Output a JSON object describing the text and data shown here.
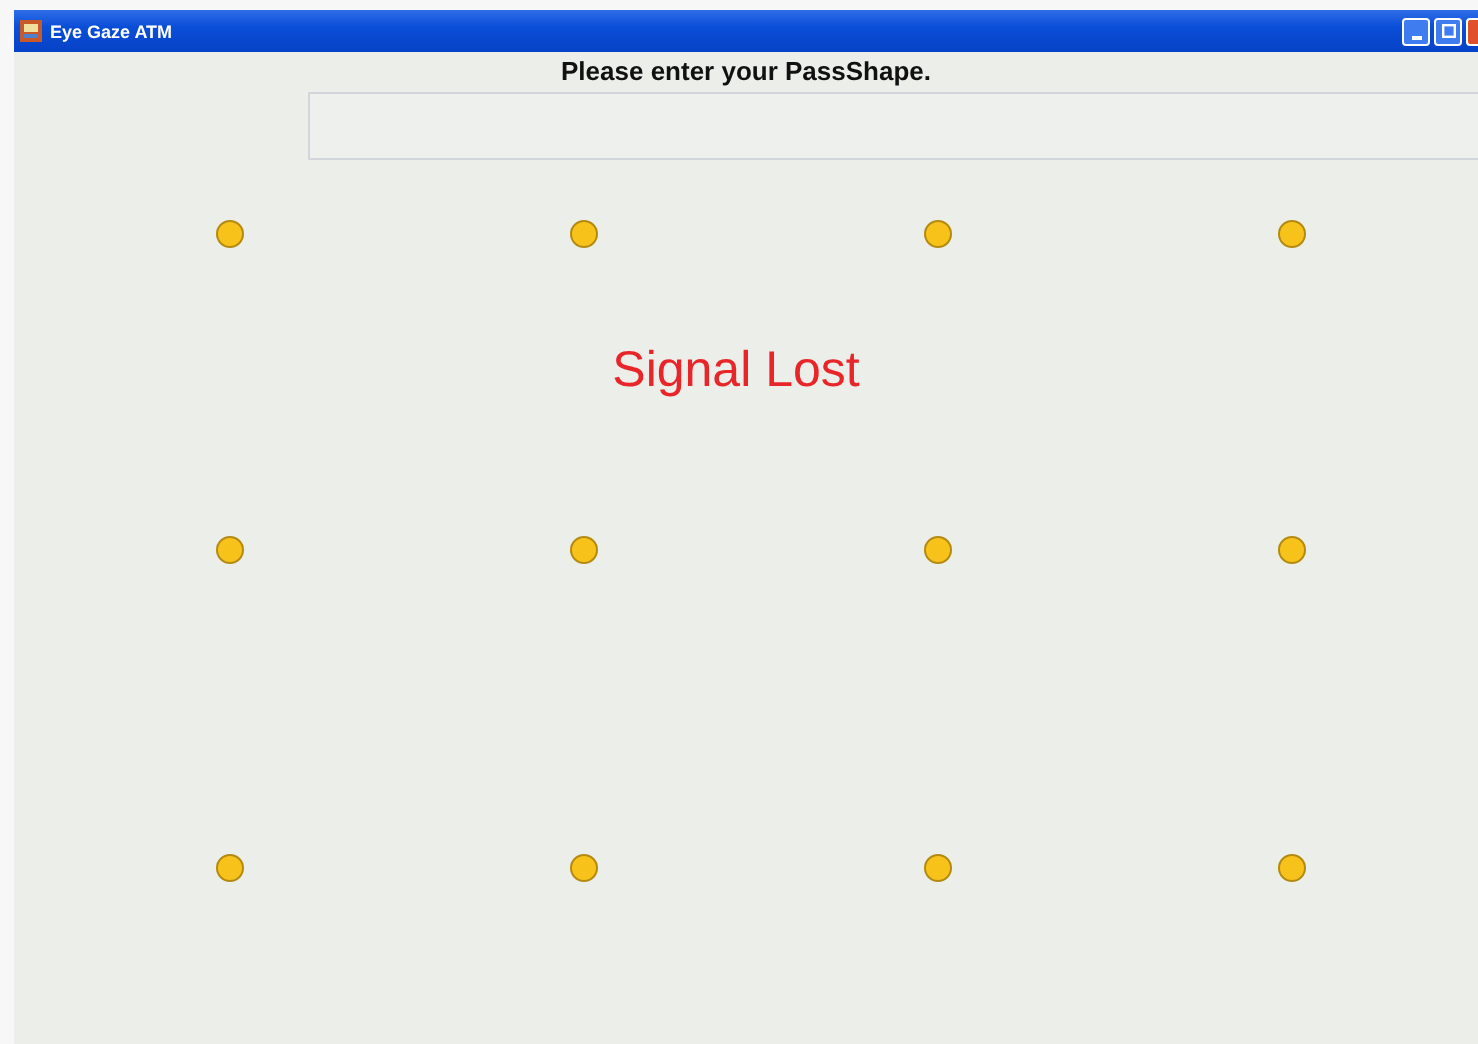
{
  "window": {
    "title": "Eye Gaze ATM"
  },
  "prompt": "Please enter your PassShape.",
  "status": "Signal Lost",
  "dot_rows": [
    [
      {
        "selected": false
      },
      {
        "selected": false
      },
      {
        "selected": false
      },
      {
        "selected": false
      }
    ],
    [
      {
        "selected": false
      },
      {
        "selected": false
      },
      {
        "selected": false
      },
      {
        "selected": false
      }
    ],
    [
      {
        "selected": false
      },
      {
        "selected": false
      },
      {
        "selected": false
      },
      {
        "selected": false
      }
    ]
  ]
}
